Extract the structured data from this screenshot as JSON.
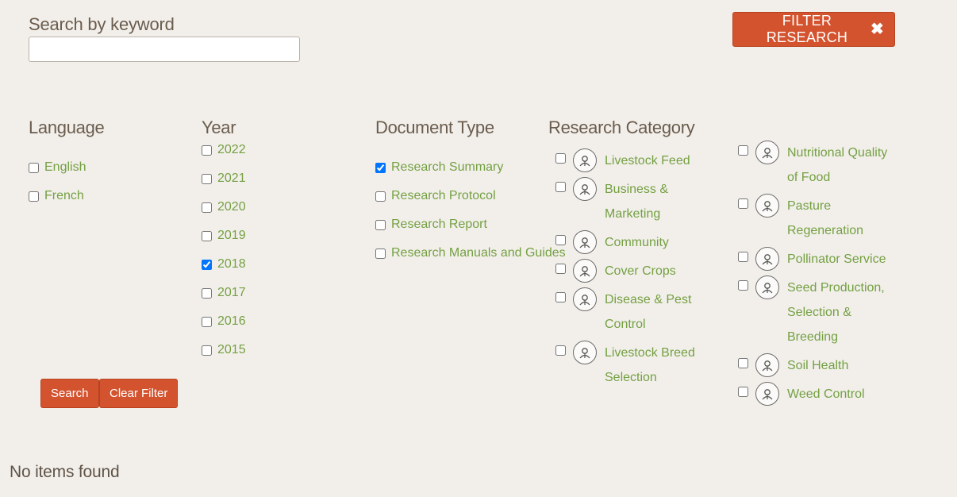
{
  "search": {
    "label": "Search by keyword",
    "value": "",
    "placeholder": ""
  },
  "filter_button": {
    "label": "FILTER RESEARCH",
    "close_glyph": "✖"
  },
  "language": {
    "title": "Language",
    "options": [
      "English",
      "French"
    ],
    "checked": []
  },
  "year": {
    "title": "Year",
    "options": [
      "2022",
      "2021",
      "2020",
      "2019",
      "2018",
      "2017",
      "2016",
      "2015"
    ],
    "checked": [
      "2018"
    ]
  },
  "doc_type": {
    "title": "Document Type",
    "options": [
      "Research Summary",
      "Research Protocol",
      "Research Report",
      "Research Manuals and Guides"
    ],
    "checked": [
      "Research Summary"
    ]
  },
  "category": {
    "title": "Research Category",
    "col1": [
      {
        "label": "Livestock Feed",
        "icon": "livestock-feed-icon"
      },
      {
        "label": "Business & Marketing",
        "icon": "business-marketing-icon"
      },
      {
        "label": "Community",
        "icon": "community-icon"
      },
      {
        "label": "Cover Crops",
        "icon": "cover-crops-icon"
      },
      {
        "label": "Disease & Pest Control",
        "icon": "disease-pest-icon"
      },
      {
        "label": "Livestock Breed Selection",
        "icon": "livestock-breed-icon"
      }
    ],
    "col2": [
      {
        "label": "Nutritional Quality of Food",
        "icon": "nutritional-quality-icon"
      },
      {
        "label": "Pasture Regeneration",
        "icon": "pasture-regeneration-icon"
      },
      {
        "label": "Pollinator Service",
        "icon": "pollinator-icon"
      },
      {
        "label": "Seed Production, Selection & Breeding",
        "icon": "seed-production-icon"
      },
      {
        "label": "Soil Health",
        "icon": "soil-health-icon"
      },
      {
        "label": "Weed Control",
        "icon": "weed-control-icon"
      }
    ]
  },
  "buttons": {
    "search": "Search",
    "clear": "Clear Filter"
  },
  "results": {
    "empty_text": "No items found"
  },
  "colors": {
    "accent": "#d4532f",
    "link_green": "#74a043",
    "background": "#f2efea",
    "heading": "#6a5c4e"
  }
}
